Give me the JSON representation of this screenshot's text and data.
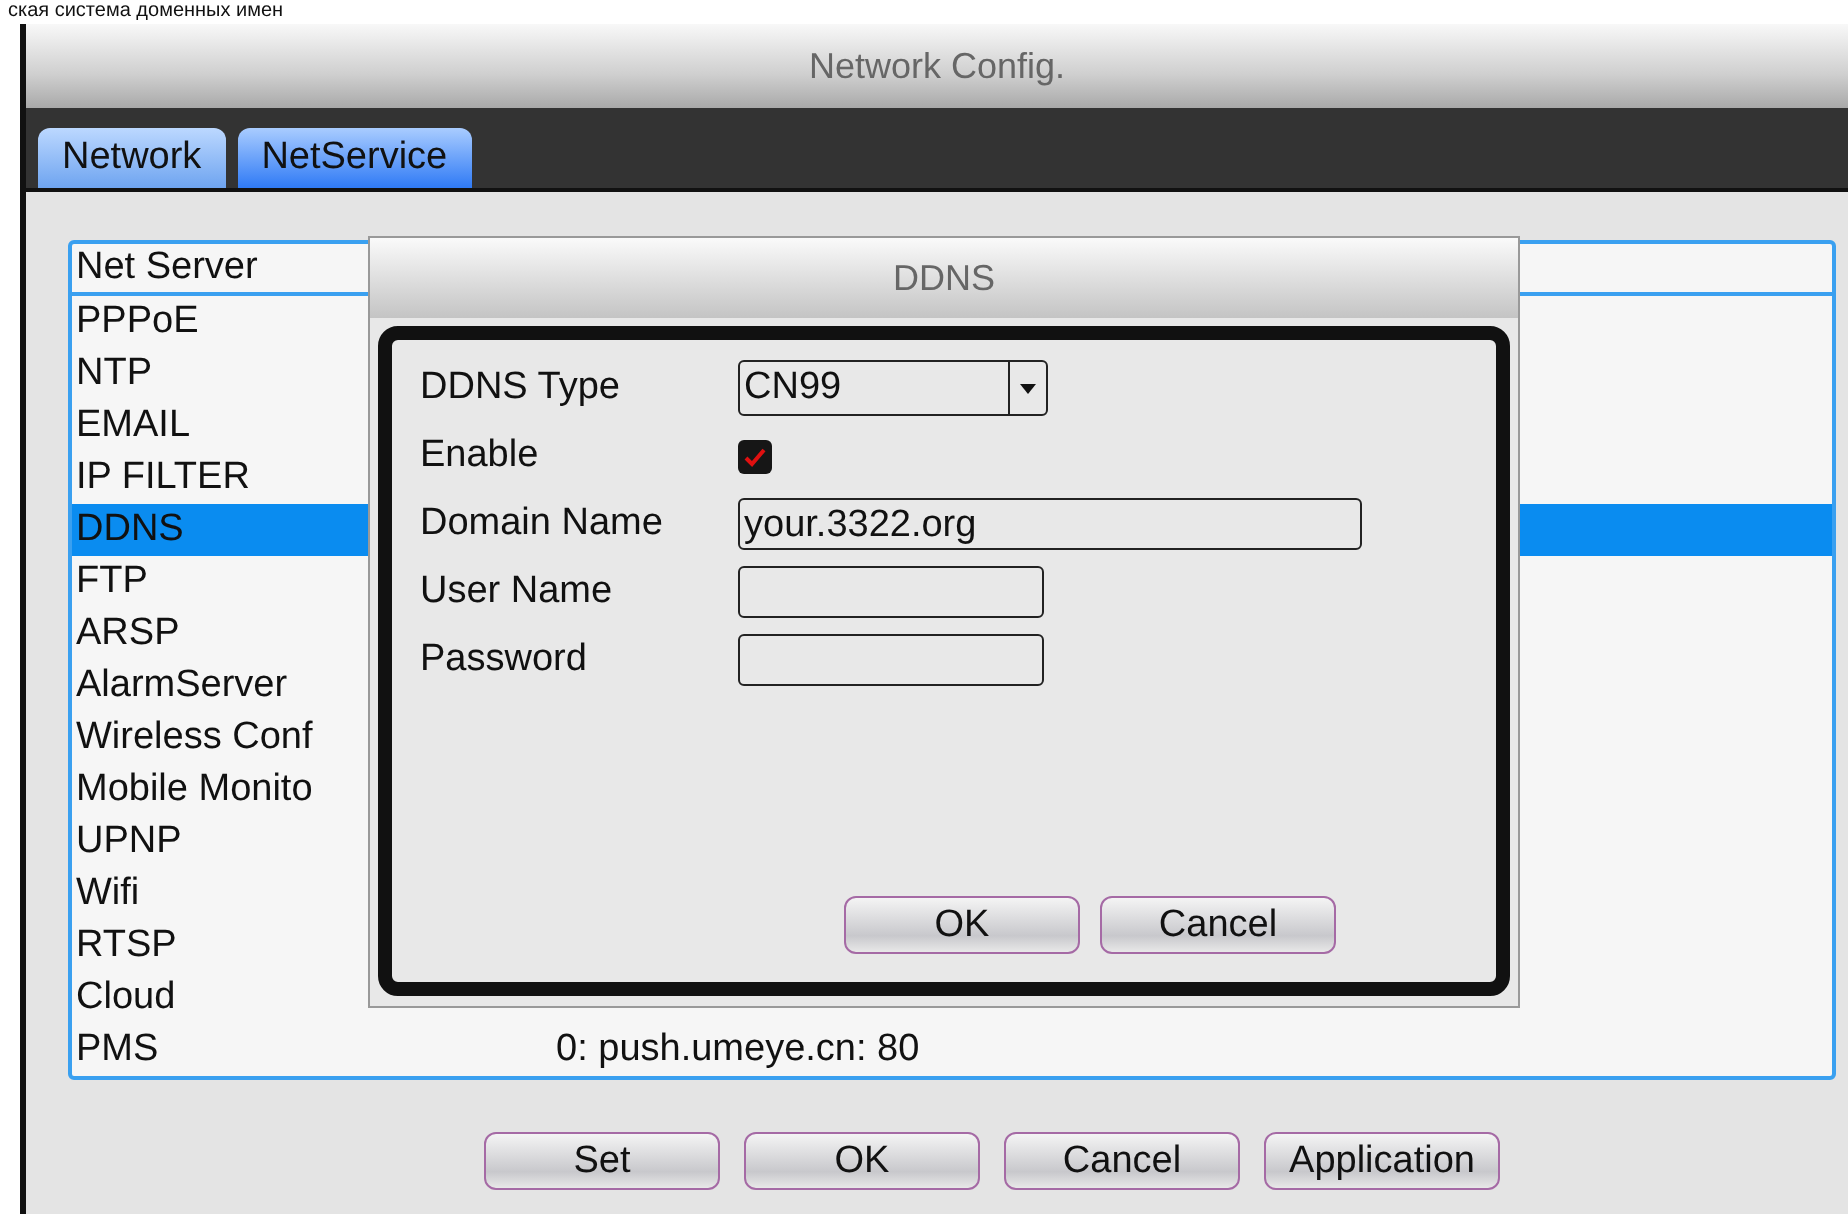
{
  "caption": "ская система доменных имен",
  "window": {
    "title": "Network Config."
  },
  "tabs": [
    {
      "label": "Network",
      "selected": false
    },
    {
      "label": "NetService",
      "selected": true
    }
  ],
  "list": {
    "header": "Net Server",
    "rows": [
      {
        "name": "PPPoE",
        "selected": false
      },
      {
        "name": "NTP",
        "selected": false
      },
      {
        "name": "EMAIL",
        "selected": false
      },
      {
        "name": "IP FILTER",
        "selected": false
      },
      {
        "name": "DDNS",
        "selected": true
      },
      {
        "name": "FTP",
        "selected": false
      },
      {
        "name": "ARSP",
        "selected": false
      },
      {
        "name": "AlarmServer",
        "selected": false
      },
      {
        "name": "Wireless Conf",
        "selected": false
      },
      {
        "name": "Mobile Monito",
        "selected": false
      },
      {
        "name": "UPNP",
        "selected": false
      },
      {
        "name": "Wifi",
        "selected": false
      },
      {
        "name": "RTSP",
        "selected": false
      },
      {
        "name": "Cloud",
        "selected": false
      },
      {
        "name": "PMS",
        "selected": false,
        "value": "0: push.umeye.cn: 80"
      }
    ]
  },
  "buttons": [
    "Set",
    "OK",
    "Cancel",
    "Application"
  ],
  "dialog": {
    "title": "DDNS",
    "fields": [
      {
        "kind": "dropdown",
        "label": "DDNS Type",
        "value": "CN99"
      },
      {
        "kind": "checkbox",
        "label": "Enable",
        "checked": true
      },
      {
        "kind": "longtext",
        "label": "Domain Name",
        "value": "your.3322.org"
      },
      {
        "kind": "text",
        "label": "User Name"
      },
      {
        "kind": "text",
        "label": "Password"
      }
    ],
    "buttons": [
      "OK",
      "Cancel"
    ]
  }
}
